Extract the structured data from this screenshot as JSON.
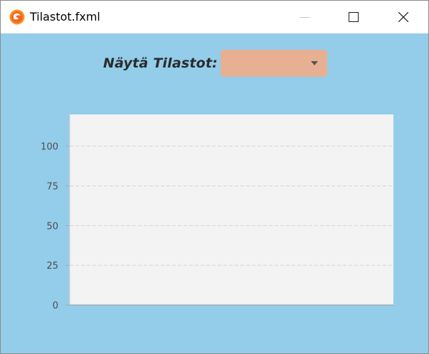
{
  "window": {
    "title": "Tilastot.fxml",
    "app_icon": "javafx-icon",
    "controls": {
      "minimize_icon": "minimize-icon",
      "maximize_icon": "maximize-icon",
      "close_icon": "close-icon"
    }
  },
  "toolbar": {
    "label": "Näytä Tilastot:",
    "combo_value": ""
  },
  "colors": {
    "background": "#93cdea",
    "combo": "#e8b093",
    "plot_area": "#f3f3f3"
  },
  "chart_data": {
    "type": "bar",
    "categories": [],
    "series": [],
    "title": "",
    "xlabel": "",
    "ylabel": "",
    "ylim": [
      0,
      120
    ],
    "yticks": [
      0,
      25,
      50,
      75,
      100
    ],
    "grid": true,
    "legend": "none"
  }
}
